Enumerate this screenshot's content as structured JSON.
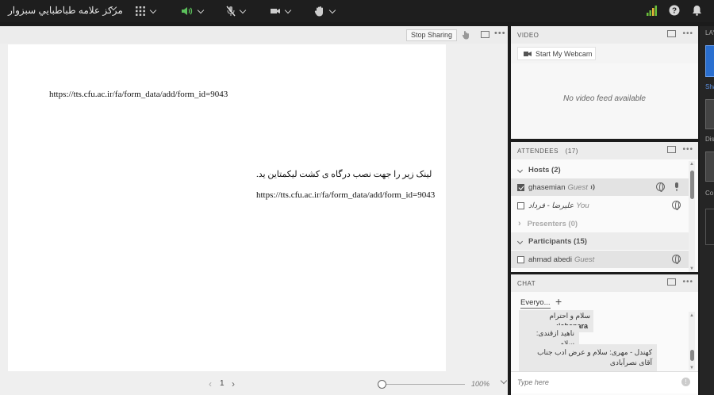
{
  "topbar": {
    "room_name": "مرکز علامه طباطبايي سبزوار",
    "icons": [
      "apps-grid-icon",
      "speaker-icon",
      "mic-muted-icon",
      "camera-icon",
      "raise-hand-icon",
      "network-bars-icon",
      "help-icon",
      "bell-icon"
    ]
  },
  "share": {
    "stop_label": "Stop Sharing",
    "lines": [
      "https://tts.cfu.ac.ir/fa/form_data/add/form_id=9043",
      "لینک زیر را جهت نصب درگاه ی کشت لیکمتاین ید.",
      "https://tts.cfu.ac.ir/fa/form_data/add/form_id=9043"
    ],
    "page": "1",
    "zoom": "100%"
  },
  "video": {
    "title": "VIDEO",
    "webcam_label": "Start My Webcam",
    "empty_text": "No video feed available"
  },
  "attendees": {
    "title": "ATTENDEES",
    "count": "(17)",
    "hosts_label": "Hosts (2)",
    "hosts": [
      {
        "name": "ghasemian",
        "role": "Guest",
        "checked": true
      },
      {
        "name": "علیرضا - فرداد",
        "role": "You",
        "checked": false
      }
    ],
    "presenters_label": "Presenters (0)",
    "participants_label": "Participants (15)",
    "participants": [
      {
        "name": "ahmad abedi",
        "role": "Guest",
        "checked": false
      }
    ]
  },
  "chat": {
    "title": "CHAT",
    "tab_label": "Everyo...",
    "messages": [
      {
        "sender": "jahanara:",
        "text": "سلام و احترام"
      },
      {
        "sender": "",
        "text": "ناهید ازقندی: سلام"
      },
      {
        "sender": "",
        "text": "کهندل - مهری: سلام و عرض ادب جناب آقای نصرآبادی"
      }
    ],
    "input_placeholder": "Type here"
  },
  "side": {
    "label": "LAY",
    "labels": [
      "Sha",
      "Dis",
      "Co"
    ]
  },
  "colors": {
    "topbar_bg": "#1e1e1e",
    "signal_green": "#6abf3a",
    "speaker_green": "#5cc15c"
  }
}
